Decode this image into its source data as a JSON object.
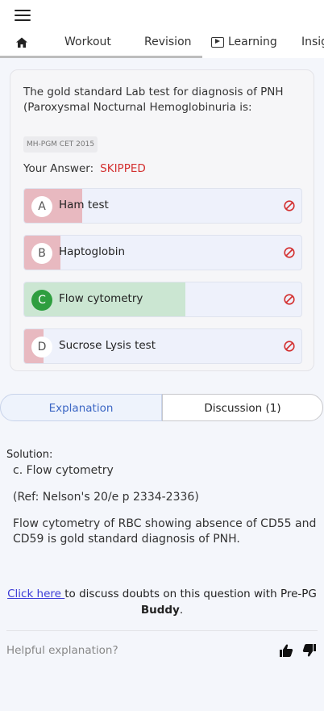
{
  "header": {
    "menu_icon": "hamburger-icon",
    "tabs": [
      {
        "label": "",
        "icon": "home-icon"
      },
      {
        "label": "Workout"
      },
      {
        "label": "Revision"
      },
      {
        "label": "Learning",
        "icon": "play-icon"
      },
      {
        "label": "Insig"
      }
    ]
  },
  "question": {
    "text": "The gold standard Lab test for diagnosis of PNH (Paroxysmal Nocturnal Hemoglobinuria is:",
    "source": "MH-PGM CET 2015",
    "your_answer_label": "Your Answer:",
    "your_answer_status": "SKIPPED",
    "options": [
      {
        "letter": "A",
        "label": "Ham test",
        "fill": 0.21,
        "correct": false
      },
      {
        "letter": "B",
        "label": "Haptoglobin",
        "fill": 0.13,
        "correct": false
      },
      {
        "letter": "C",
        "label": "Flow cytometry",
        "fill": 0.58,
        "correct": true
      },
      {
        "letter": "D",
        "label": "Sucrose Lysis test",
        "fill": 0.07,
        "correct": false
      }
    ],
    "colors": {
      "wrong_fill": "#e8b9c0",
      "correct_fill": "#cbe6d2",
      "status_red": "#d32f2f"
    }
  },
  "explanation_tabs": {
    "explanation": "Explanation",
    "discussion": "Discussion (1)"
  },
  "solution": {
    "heading": "Solution:",
    "answer": "c. Flow cytometry",
    "reference": "(Ref: Nelson's 20/e p 2334-2336)",
    "detail": "Flow cytometry of RBC showing absence of CD55 and CD59 is gold standard diagnosis of PNH."
  },
  "discuss": {
    "link": "Click here ",
    "text": "to discuss doubts on this question with Pre-PG ",
    "bold": "Buddy",
    "end": "."
  },
  "feedback": {
    "label": "Helpful explanation?",
    "up_icon": "thumbs-up-icon",
    "down_icon": "thumbs-down-icon"
  }
}
